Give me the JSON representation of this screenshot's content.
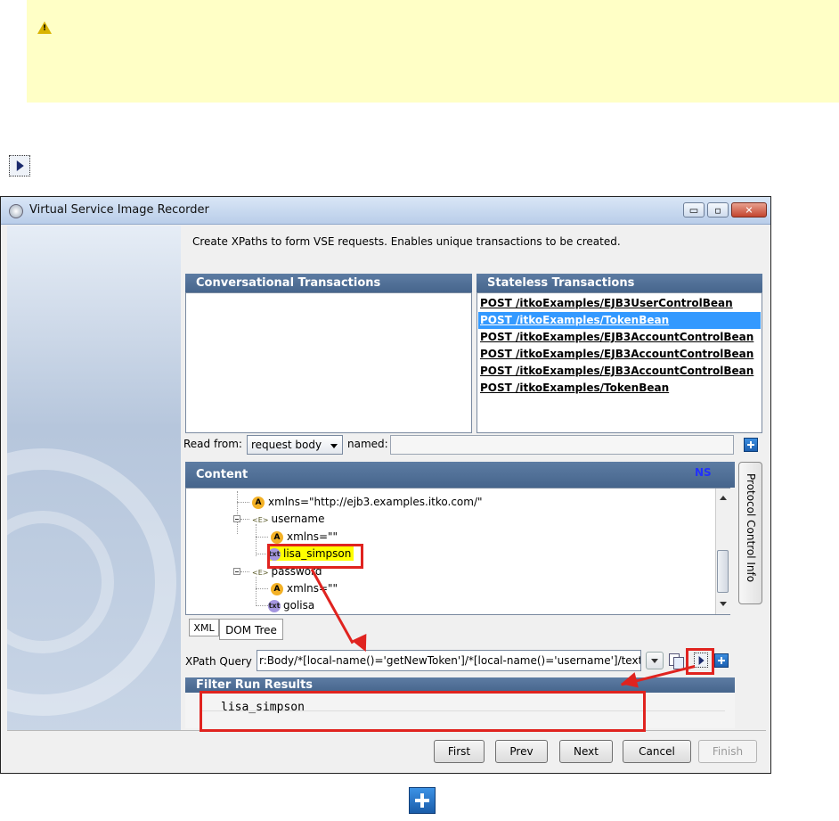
{
  "warning": {
    "icon": "warning-icon",
    "icon_glyph": "!",
    "color": "#ffffc6"
  },
  "standalone_icons": [
    "play-icon",
    "add-icon"
  ],
  "window": {
    "title": "Virtual Service Image Recorder",
    "controls": {
      "minimize": "▭",
      "maximize": "▫",
      "close": "✕"
    }
  },
  "instructions": "Create XPaths to form VSE requests.  Enables unique transactions to be created.",
  "conversational": {
    "header": "Conversational Transactions"
  },
  "stateless": {
    "header": "Stateless Transactions",
    "selected_index": 1,
    "items": [
      "POST /itkoExamples/EJB3UserControlBean",
      "POST /itkoExamples/TokenBean",
      "POST /itkoExamples/EJB3AccountControlBean",
      "POST /itkoExamples/EJB3AccountControlBean",
      "POST /itkoExamples/EJB3AccountControlBean",
      "POST /itkoExamples/TokenBean"
    ]
  },
  "read_from": {
    "label": "Read from:",
    "value": "request body",
    "named_label": "named:",
    "named_value": ""
  },
  "content": {
    "header": "Content",
    "ns": "NS",
    "side_tab": "Protocol Control Info",
    "tree": [
      {
        "kind": "A",
        "text": "xmlns=\"http://ejb3.examples.itko.com/\""
      },
      {
        "kind": "E",
        "text": "username"
      },
      {
        "kind": "A",
        "text": "xmlns=\"\""
      },
      {
        "kind": "txt",
        "text": "lisa_simpson",
        "highlight": true
      },
      {
        "kind": "E",
        "text": "password"
      },
      {
        "kind": "A",
        "text": "xmlns=\"\""
      },
      {
        "kind": "txt",
        "text": "golisa"
      }
    ],
    "badges": {
      "A": "A",
      "E": "<E>",
      "txt": "txt"
    },
    "tabs": [
      "XML",
      "DOM Tree"
    ],
    "active_tab": "DOM Tree"
  },
  "xpath": {
    "label": "XPath Query",
    "value": "r:Body/*[local-name()='getNewToken']/*[local-name()='username']/text()"
  },
  "filter": {
    "header": "Filter Run Results",
    "result": "lisa_simpson"
  },
  "buttons": {
    "first": "First",
    "prev": "Prev",
    "next": "Next",
    "cancel": "Cancel",
    "finish": "Finish"
  },
  "colors": {
    "header_blue": "#4f6f98",
    "selection": "#3399ff",
    "highlight": "#ffff00",
    "annotation_red": "#e0231f"
  }
}
